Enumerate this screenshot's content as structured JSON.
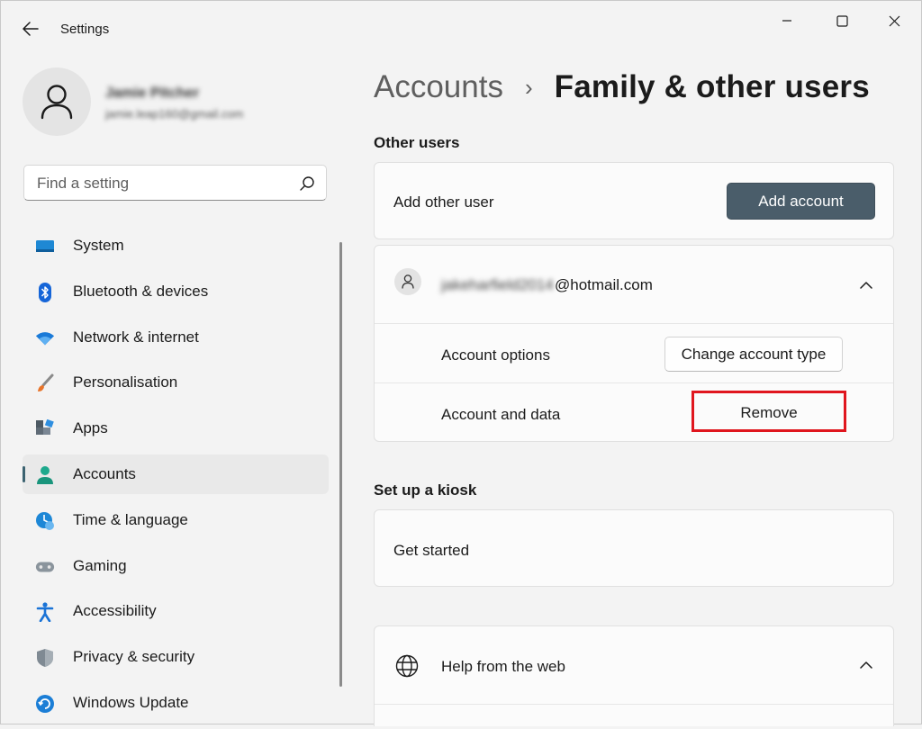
{
  "window": {
    "title": "Settings",
    "back_icon": "arrow-left-icon",
    "controls": [
      "minimize-icon",
      "maximize-icon",
      "close-icon"
    ]
  },
  "profile": {
    "name": "Jamie Pitcher",
    "email": "jamie.leap160@gmail.com"
  },
  "search": {
    "placeholder": "Find a setting",
    "icon": "search-icon"
  },
  "sidebar": {
    "items": [
      {
        "label": "System",
        "icon": "system-icon",
        "active": false
      },
      {
        "label": "Bluetooth & devices",
        "icon": "bluetooth-icon",
        "active": false
      },
      {
        "label": "Network & internet",
        "icon": "wifi-icon",
        "active": false
      },
      {
        "label": "Personalisation",
        "icon": "brush-icon",
        "active": false
      },
      {
        "label": "Apps",
        "icon": "apps-icon",
        "active": false
      },
      {
        "label": "Accounts",
        "icon": "accounts-icon",
        "active": true
      },
      {
        "label": "Time & language",
        "icon": "time-language-icon",
        "active": false
      },
      {
        "label": "Gaming",
        "icon": "gamepad-icon",
        "active": false
      },
      {
        "label": "Accessibility",
        "icon": "accessibility-icon",
        "active": false
      },
      {
        "label": "Privacy & security",
        "icon": "shield-icon",
        "active": false
      },
      {
        "label": "Windows Update",
        "icon": "update-icon",
        "active": false
      }
    ]
  },
  "breadcrumb": {
    "parent": "Accounts",
    "separator": "›",
    "current": "Family & other users"
  },
  "other_users": {
    "title": "Other users",
    "add_label": "Add other user",
    "add_button": "Add account",
    "user": {
      "email_blurred": "jakeharfield2014",
      "email_domain": "@hotmail.com",
      "options_label": "Account options",
      "options_button": "Change account type",
      "data_label": "Account and data",
      "remove_button": "Remove"
    }
  },
  "kiosk": {
    "title": "Set up a kiosk",
    "get_started": "Get started"
  },
  "help": {
    "label": "Help from the web"
  },
  "colors": {
    "accent": "#4a5d6a",
    "highlight": "#e0161e",
    "background": "#f3f3f3"
  }
}
